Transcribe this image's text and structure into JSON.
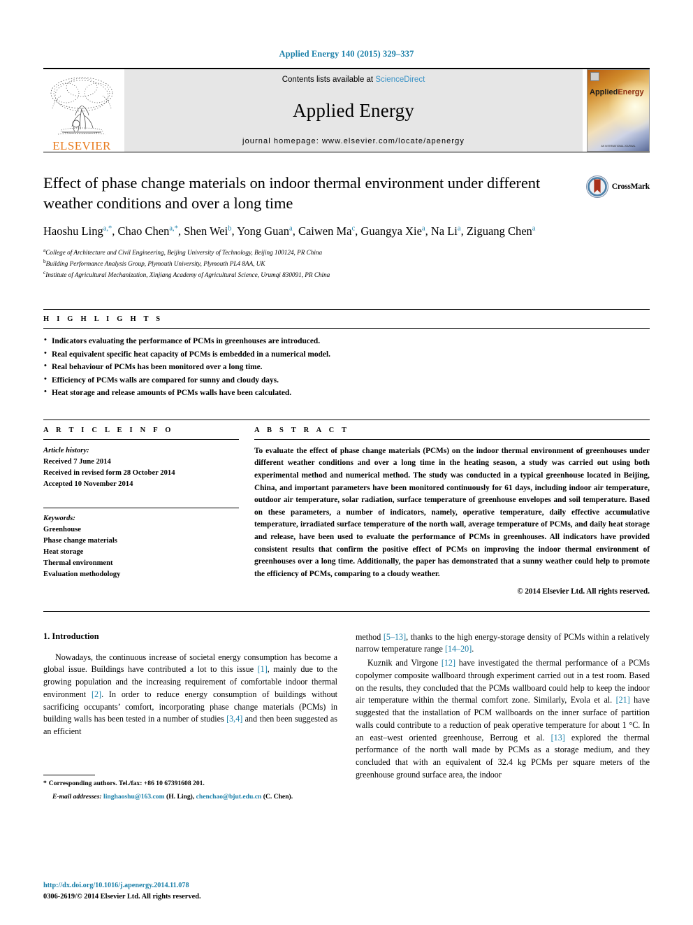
{
  "journal_ref": "Applied Energy 140 (2015) 329–337",
  "masthead": {
    "publisher_name": "ELSEVIER",
    "contents_prefix": "Contents lists available at ",
    "sciencedirect": "ScienceDirect",
    "journal_title": "Applied Energy",
    "homepage": "journal homepage: www.elsevier.com/locate/apenergy",
    "cover_label_1": "Applied",
    "cover_label_2": "Energy",
    "cover_footer": "AN INTERNATIONAL JOURNAL"
  },
  "article": {
    "title": "Effect of phase change materials on indoor thermal environment under different weather conditions and over a long time",
    "crossmark_label": "CrossMark",
    "authors": [
      {
        "name": "Haoshu Ling",
        "sup": "a,*",
        "sep": ", "
      },
      {
        "name": "Chao Chen",
        "sup": "a,*",
        "sep": ", "
      },
      {
        "name": "Shen Wei",
        "sup": "b",
        "sep": ", "
      },
      {
        "name": "Yong Guan",
        "sup": "a",
        "sep": ", "
      },
      {
        "name": "Caiwen Ma",
        "sup": "c",
        "sep": ", "
      },
      {
        "name": "Guangya Xie",
        "sup": "a",
        "sep": ", "
      },
      {
        "name": "Na Li",
        "sup": "a",
        "sep": ","
      },
      {
        "name": "Ziguang Chen",
        "sup": "a",
        "sep": ""
      }
    ],
    "affiliations": [
      {
        "marker": "a",
        "text": "College of Architecture and Civil Engineering, Beijing University of Technology, Beijing 100124, PR China"
      },
      {
        "marker": "b",
        "text": "Building Performance Analysis Group, Plymouth University, Plymouth PL4 8AA, UK"
      },
      {
        "marker": "c",
        "text": "Institute of Agricultural Mechanization, Xinjiang Academy of Agricultural Science, Urumqi 830091, PR China"
      }
    ]
  },
  "highlights": {
    "heading": "H I G H L I G H T S",
    "items": [
      "Indicators evaluating the performance of PCMs in greenhouses are introduced.",
      "Real equivalent specific heat capacity of PCMs is embedded in a numerical model.",
      "Real behaviour of PCMs has been monitored over a long time.",
      "Efficiency of PCMs walls are compared for sunny and cloudy days.",
      "Heat storage and release amounts of PCMs walls have been calculated."
    ]
  },
  "article_info": {
    "heading": "A R T I C L E    I N F O",
    "history_label": "Article history:",
    "history": [
      "Received 7 June 2014",
      "Received in revised form 28 October 2014",
      "Accepted 10 November 2014"
    ],
    "keywords_label": "Keywords:",
    "keywords": [
      "Greenhouse",
      "Phase change materials",
      "Heat storage",
      "Thermal environment",
      "Evaluation methodology"
    ]
  },
  "abstract": {
    "heading": "A B S T R A C T",
    "text": "To evaluate the effect of phase change materials (PCMs) on the indoor thermal environment of greenhouses under different weather conditions and over a long time in the heating season, a study was carried out using both experimental method and numerical method. The study was conducted in a typical greenhouse located in Beijing, China, and important parameters have been monitored continuously for 61 days, including indoor air temperature, outdoor air temperature, solar radiation, surface temperature of greenhouse envelopes and soil temperature. Based on these parameters, a number of indicators, namely, operative temperature, daily effective accumulative temperature, irradiated surface temperature of the north wall, average temperature of PCMs, and daily heat storage and release, have been used to evaluate the performance of PCMs in greenhouses. All indicators have provided consistent results that confirm the positive effect of PCMs on improving the indoor thermal environment of greenhouses over a long time. Additionally, the paper has demonstrated that a sunny weather could help to promote the efficiency of PCMs, comparing to a cloudy weather.",
    "copyright": "© 2014 Elsevier Ltd. All rights reserved."
  },
  "introduction": {
    "heading": "1. Introduction",
    "left_paragraph_parts": [
      {
        "t": "Nowadays, the continuous increase of societal energy consumption has become a global issue. Buildings have contributed a lot to this issue ",
        "c": false
      },
      {
        "t": "[1]",
        "c": true
      },
      {
        "t": ", mainly due to the growing population and the increasing requirement of comfortable indoor thermal environment ",
        "c": false
      },
      {
        "t": "[2]",
        "c": true
      },
      {
        "t": ". In order to reduce energy consumption of buildings without sacrificing occupants’ comfort, incorporating phase change materials (PCMs) in building walls has been tested in a number of studies ",
        "c": false
      },
      {
        "t": "[3,4]",
        "c": true
      },
      {
        "t": " and then been suggested as an efficient",
        "c": false
      }
    ],
    "right_paragraph1_parts": [
      {
        "t": "method ",
        "c": false
      },
      {
        "t": "[5–13]",
        "c": true
      },
      {
        "t": ", thanks to the high energy-storage density of PCMs within a relatively narrow temperature range ",
        "c": false
      },
      {
        "t": "[14–20]",
        "c": true
      },
      {
        "t": ".",
        "c": false
      }
    ],
    "right_paragraph2_parts": [
      {
        "t": "Kuznik and Virgone ",
        "c": false
      },
      {
        "t": "[12]",
        "c": true
      },
      {
        "t": " have investigated the thermal performance of a PCMs copolymer composite wallboard through experiment carried out in a test room. Based on the results, they concluded that the PCMs wallboard could help to keep the indoor air temperature within the thermal comfort zone. Similarly, Evola et al. ",
        "c": false
      },
      {
        "t": "[21]",
        "c": true
      },
      {
        "t": " have suggested that the installation of PCM wallboards on the inner surface of partition walls could contribute to a reduction of peak operative temperature for about 1 °C. In an east–west oriented greenhouse, Berroug et al. ",
        "c": false
      },
      {
        "t": "[13]",
        "c": true
      },
      {
        "t": " explored the thermal performance of the north wall made by PCMs as a storage medium, and they concluded that with an equivalent of 32.4 kg PCMs per square meters of the greenhouse ground surface area, the indoor",
        "c": false
      }
    ]
  },
  "footnotes": {
    "corresponding_star": "*",
    "corresponding": "Corresponding authors. Tel./fax: +86 10 67391608 201.",
    "email_label": "E-mail addresses:",
    "email_1": "linghaoshu@163.com",
    "email_1_owner": "(H. Ling),",
    "email_2": "chenchao@bjut.edu.cn",
    "email_2_owner": "(C. Chen)."
  },
  "footer": {
    "doi": "http://dx.doi.org/10.1016/j.apenergy.2014.11.078",
    "issn": "0306-2619/© 2014 Elsevier Ltd. All rights reserved."
  },
  "colors": {
    "link_blue": "#1a7fa8",
    "sciencedirect_blue": "#3b93c6",
    "elsevier_orange": "#e87b1e",
    "banner_gray": "#e6e6e6",
    "crossmark_red": "#a8301a",
    "crossmark_blue": "#4a7fa8"
  }
}
